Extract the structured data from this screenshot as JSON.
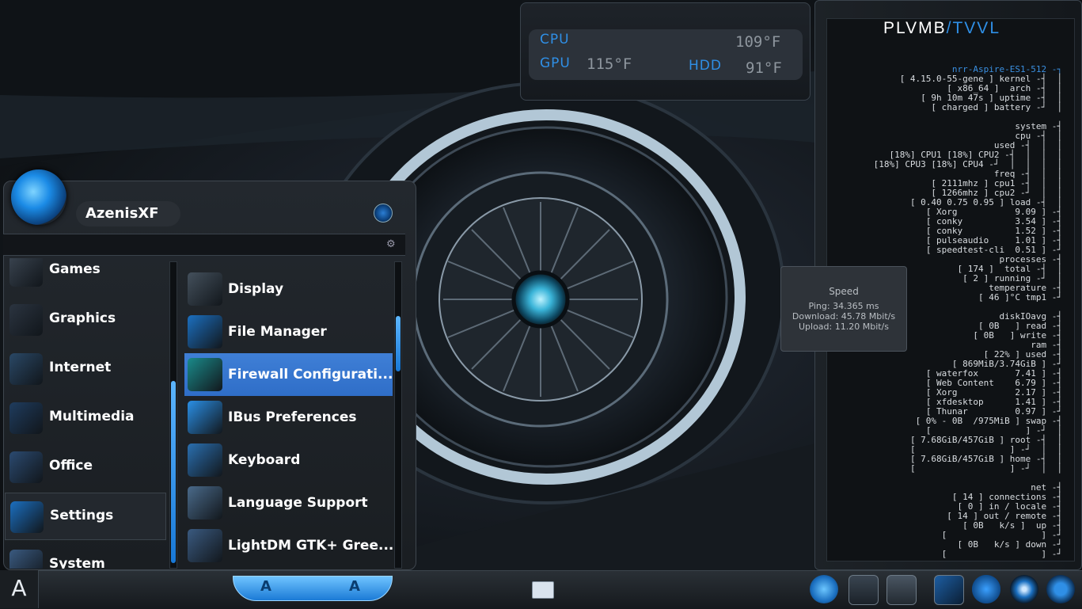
{
  "temps": {
    "cpu_label": "CPU",
    "gpu_label": "GPU",
    "hdd_label": "HDD",
    "cpu_value": "109°F",
    "gpu_value": "115°F",
    "hdd_value": "91°F"
  },
  "conky": {
    "title_a": "PLVMB",
    "title_b": "/TVVL",
    "lines": [
      {
        "t": "nrr-Aspire-ES1-512 -┐",
        "c": "b"
      },
      {
        "t": "[ 4.15.0-55-gene ] kernel -┤  │",
        "c": ""
      },
      {
        "t": "[ x86_64 ]  arch -┤  │",
        "c": ""
      },
      {
        "t": "[ 9h 10m 47s ] uptime -┤  │",
        "c": ""
      },
      {
        "t": "[ charged ] battery -┘  │",
        "c": ""
      },
      {
        "t": "",
        "c": ""
      },
      {
        "t": "system -┤",
        "c": ""
      },
      {
        "t": "cpu -┤  │",
        "c": ""
      },
      {
        "t": "used -┤  │  │",
        "c": ""
      },
      {
        "t": "[18%] CPU1 [18%] CPU2 -┤  │  │  │",
        "c": ""
      },
      {
        "t": "[18%] CPU3 [18%] CPU4 -┘  │  │  │  │",
        "c": ""
      },
      {
        "t": "freq -┤  │  │",
        "c": ""
      },
      {
        "t": "[ 2111mhz ] cpu1 -┤  │  │",
        "c": ""
      },
      {
        "t": "[ 1266mhz ] cpu2 -┘  │  │",
        "c": ""
      },
      {
        "t": "[ 0.40 0.75 0.95 ] load -┤  │",
        "c": ""
      },
      {
        "t": "[ Xorg           9.09 ] -┤",
        "c": ""
      },
      {
        "t": "[ conky          3.54 ] -┤",
        "c": ""
      },
      {
        "t": "[ conky          1.52 ] -┤",
        "c": ""
      },
      {
        "t": "[ pulseaudio     1.01 ] -┤",
        "c": ""
      },
      {
        "t": "[ speedtest-cli  0.51 ] -┘",
        "c": ""
      },
      {
        "t": "processes -┤",
        "c": ""
      },
      {
        "t": "[ 174 ]  total -┤  │",
        "c": ""
      },
      {
        "t": "[ 2 ] running -┘  │",
        "c": ""
      },
      {
        "t": "temperature -┤",
        "c": ""
      },
      {
        "t": "[ 46 ]°C tmp1 -┘",
        "c": ""
      },
      {
        "t": "",
        "c": ""
      },
      {
        "t": "diskIOavg -┤",
        "c": ""
      },
      {
        "t": "[ 0B   ] read -┤",
        "c": ""
      },
      {
        "t": "[ 0B   ] write -┤",
        "c": ""
      },
      {
        "t": "ram -┤",
        "c": ""
      },
      {
        "t": "[ 22% ] used -┤",
        "c": ""
      },
      {
        "t": "[ 869MiB/3.74GiB ] -┘",
        "c": ""
      },
      {
        "t": "[ waterfox       7.41 ] -┤",
        "c": ""
      },
      {
        "t": "[ Web Content    6.79 ] -┤",
        "c": ""
      },
      {
        "t": "[ Xorg           2.17 ] -┤",
        "c": ""
      },
      {
        "t": "[ xfdesktop      1.41 ] -┤",
        "c": ""
      },
      {
        "t": "[ Thunar         0.97 ] -┘",
        "c": ""
      },
      {
        "t": "[ 0% - 0B  /975MiB ] swap -┤",
        "c": ""
      },
      {
        "t": "[                  ] -┘  │",
        "c": ""
      },
      {
        "t": "[ 7.68GiB/457GiB ] root -┤  │",
        "c": ""
      },
      {
        "t": "[                  ] -┘  │  │",
        "c": ""
      },
      {
        "t": "[ 7.68GiB/457GiB ] home -┤  │",
        "c": ""
      },
      {
        "t": "[                  ] -┘  │  │",
        "c": ""
      },
      {
        "t": "",
        "c": ""
      },
      {
        "t": "net -┤",
        "c": ""
      },
      {
        "t": "[ 14 ] connections -┤",
        "c": ""
      },
      {
        "t": "[ 0 ] in / locale -┤",
        "c": ""
      },
      {
        "t": "[ 14 ] out / remote -┤",
        "c": ""
      },
      {
        "t": "[ 0B   k/s ]  up -┤",
        "c": ""
      },
      {
        "t": "[                  ] -┘",
        "c": ""
      },
      {
        "t": "[ 0B   k/s ] down -┘",
        "c": ""
      },
      {
        "t": "[                  ] -┘",
        "c": ""
      }
    ]
  },
  "speed": {
    "title": "Speed",
    "ping": "Ping: 34.365 ms",
    "download": "Download: 45.78 Mbit/s",
    "upload": "Upload: 11.20 Mbit/s"
  },
  "menu": {
    "username": "AzenisXF",
    "search_placeholder": "",
    "categories": [
      {
        "label": "Games",
        "icon": "gamepad-icon"
      },
      {
        "label": "Graphics",
        "icon": "graphics-tablet-icon"
      },
      {
        "label": "Internet",
        "icon": "network-icon"
      },
      {
        "label": "Multimedia",
        "icon": "multimedia-icon"
      },
      {
        "label": "Office",
        "icon": "office-icon"
      },
      {
        "label": "Settings",
        "icon": "settings-icon"
      },
      {
        "label": "System",
        "icon": "system-gear-icon"
      }
    ],
    "apps": [
      {
        "label": "Display",
        "icon": "display-icon"
      },
      {
        "label": "File Manager",
        "icon": "folder-icon"
      },
      {
        "label": "Firewall Configurati...",
        "icon": "firewall-icon"
      },
      {
        "label": "IBus Preferences",
        "icon": "gear-icon"
      },
      {
        "label": "Keyboard",
        "icon": "keyboard-icon"
      },
      {
        "label": "Language Support",
        "icon": "flag-icon"
      },
      {
        "label": "LightDM GTK+ Gree...",
        "icon": "lightdm-icon"
      }
    ]
  },
  "taskbar": {
    "start_glyph": "A",
    "pill_glyph": "A"
  },
  "colors": {
    "accent": "#2f8fe6",
    "selection": "#3a78d0"
  }
}
